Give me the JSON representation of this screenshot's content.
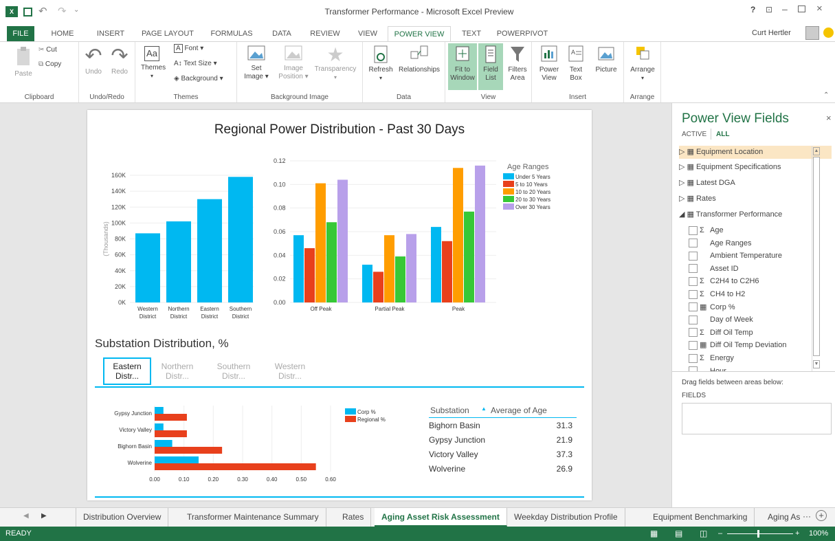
{
  "window": {
    "title": "Transformer Performance - Microsoft Excel Preview",
    "user": "Curt Hertler",
    "help": "?"
  },
  "ribbon_tabs": [
    "FILE",
    "HOME",
    "INSERT",
    "PAGE LAYOUT",
    "FORMULAS",
    "DATA",
    "REVIEW",
    "VIEW",
    "POWER VIEW",
    "TEXT",
    "POWERPIVOT"
  ],
  "ribbon": {
    "clipboard": {
      "label": "Clipboard",
      "paste": "Paste",
      "cut": "Cut",
      "copy": "Copy"
    },
    "undo_redo": {
      "label": "Undo/Redo",
      "undo": "Undo",
      "redo": "Redo"
    },
    "themes": {
      "label": "Themes",
      "themes": "Themes",
      "font": "Font",
      "text_size": "Text Size",
      "background": "Background"
    },
    "background_image": {
      "label": "Background Image",
      "set_image_1": "Set",
      "set_image_2": "Image",
      "image_position_1": "Image",
      "image_position_2": "Position",
      "transparency": "Transparency"
    },
    "data": {
      "label": "Data",
      "refresh": "Refresh",
      "relationships": "Relationships"
    },
    "view": {
      "label": "View",
      "fit_1": "Fit to",
      "fit_2": "Window",
      "field_1": "Field",
      "field_2": "List",
      "filters_1": "Filters",
      "filters_2": "Area"
    },
    "insert": {
      "label": "Insert",
      "power_1": "Power",
      "power_2": "View",
      "text_1": "Text",
      "text_2": "Box",
      "picture": "Picture"
    },
    "arrange": {
      "label": "Arrange",
      "arrange": "Arrange"
    }
  },
  "report": {
    "title": "Regional Power Distribution - Past 30 Days",
    "section_title": "Substation Distribution, %",
    "slicer": [
      "Eastern Distr...",
      "Northern Distr...",
      "Southern Distr...",
      "Western Distr..."
    ],
    "table": {
      "headers": [
        "Substation",
        "Average of Age"
      ],
      "sort_glyph": "▲",
      "rows": [
        [
          "Bighorn Basin",
          "31.3"
        ],
        [
          "Gypsy Junction",
          "21.9"
        ],
        [
          "Victory Valley",
          "37.3"
        ],
        [
          "Wolverine",
          "26.9"
        ]
      ]
    }
  },
  "chart_data": [
    {
      "type": "bar",
      "categories": [
        "Western District",
        "Northern District",
        "Eastern District",
        "Southern District"
      ],
      "values": [
        87000,
        102000,
        130000,
        158000
      ],
      "ylabel": "(Thousands)",
      "yticks": [
        "0K",
        "20K",
        "40K",
        "60K",
        "80K",
        "100K",
        "120K",
        "140K",
        "160K"
      ],
      "ylim": [
        0,
        160000
      ],
      "colors": [
        "#00b8f1"
      ]
    },
    {
      "type": "bar",
      "categories": [
        "Off Peak",
        "Partial Peak",
        "Peak"
      ],
      "legend_title": "Age Ranges",
      "series": [
        {
          "name": "Under 5 Years",
          "values": [
            0.057,
            0.032,
            0.064
          ],
          "color": "#00b8f1"
        },
        {
          "name": "5 to 10 Years",
          "values": [
            0.046,
            0.026,
            0.052
          ],
          "color": "#e8401c"
        },
        {
          "name": "10 to 20 Years",
          "values": [
            0.101,
            0.057,
            0.114
          ],
          "color": "#ff9d00"
        },
        {
          "name": "20 to 30 Years",
          "values": [
            0.068,
            0.039,
            0.077
          ],
          "color": "#37c837"
        },
        {
          "name": "Over 30 Years",
          "values": [
            0.104,
            0.058,
            0.116
          ],
          "color": "#b8a0ea"
        }
      ],
      "ylim": [
        0,
        0.12
      ],
      "yticks": [
        "0.00",
        "0.02",
        "0.04",
        "0.06",
        "0.08",
        "0.10",
        "0.12"
      ],
      "legend": "right"
    },
    {
      "type": "bar",
      "orientation": "horizontal",
      "categories": [
        "Gypsy Junction",
        "Victory Valley",
        "Bighorn Basin",
        "Wolverine"
      ],
      "series": [
        {
          "name": "Corp %",
          "values": [
            0.03,
            0.03,
            0.06,
            0.15
          ],
          "color": "#00b8f1"
        },
        {
          "name": "Regional %",
          "values": [
            0.11,
            0.11,
            0.23,
            0.55
          ],
          "color": "#e8401c"
        }
      ],
      "xlim": [
        0,
        0.6
      ],
      "xticks": [
        "0.00",
        "0.10",
        "0.20",
        "0.30",
        "0.40",
        "0.50",
        "0.60"
      ],
      "legend": "right"
    }
  ],
  "fields_pane": {
    "title": "Power View Fields",
    "tabs": [
      "ACTIVE",
      "ALL"
    ],
    "tables": [
      "Equipment Location",
      "Equipment Specifications",
      "Latest DGA",
      "Rates",
      "Transformer Performance"
    ],
    "fields": [
      {
        "name": "Age",
        "sigma": true
      },
      {
        "name": "Age Ranges",
        "sigma": false
      },
      {
        "name": "Ambient Temperature",
        "sigma": false
      },
      {
        "name": "Asset ID",
        "sigma": false
      },
      {
        "name": "C2H4 to C2H6",
        "sigma": true
      },
      {
        "name": "CH4 to H2",
        "sigma": true
      },
      {
        "name": "Corp %",
        "calc": true
      },
      {
        "name": "Day of Week",
        "sigma": false
      },
      {
        "name": "Diff Oil Temp",
        "sigma": true
      },
      {
        "name": "Diff Oil Temp Deviation",
        "calc": true
      },
      {
        "name": "Energy",
        "sigma": true
      },
      {
        "name": "Hour",
        "sigma": false
      }
    ],
    "drag_hint": "Drag fields between areas below:",
    "fields_area": "FIELDS"
  },
  "sheet_tabs": [
    "Distribution Overview",
    "Transformer Maintenance Summary",
    "Rates",
    "Aging Asset Risk Assessment",
    "Weekday Distribution Profile",
    "Equipment Benchmarking",
    "Aging As"
  ],
  "status": {
    "ready": "READY",
    "zoom": "100%"
  },
  "colors": {
    "excel_green": "#217346",
    "accent_blue": "#00b8f1"
  }
}
